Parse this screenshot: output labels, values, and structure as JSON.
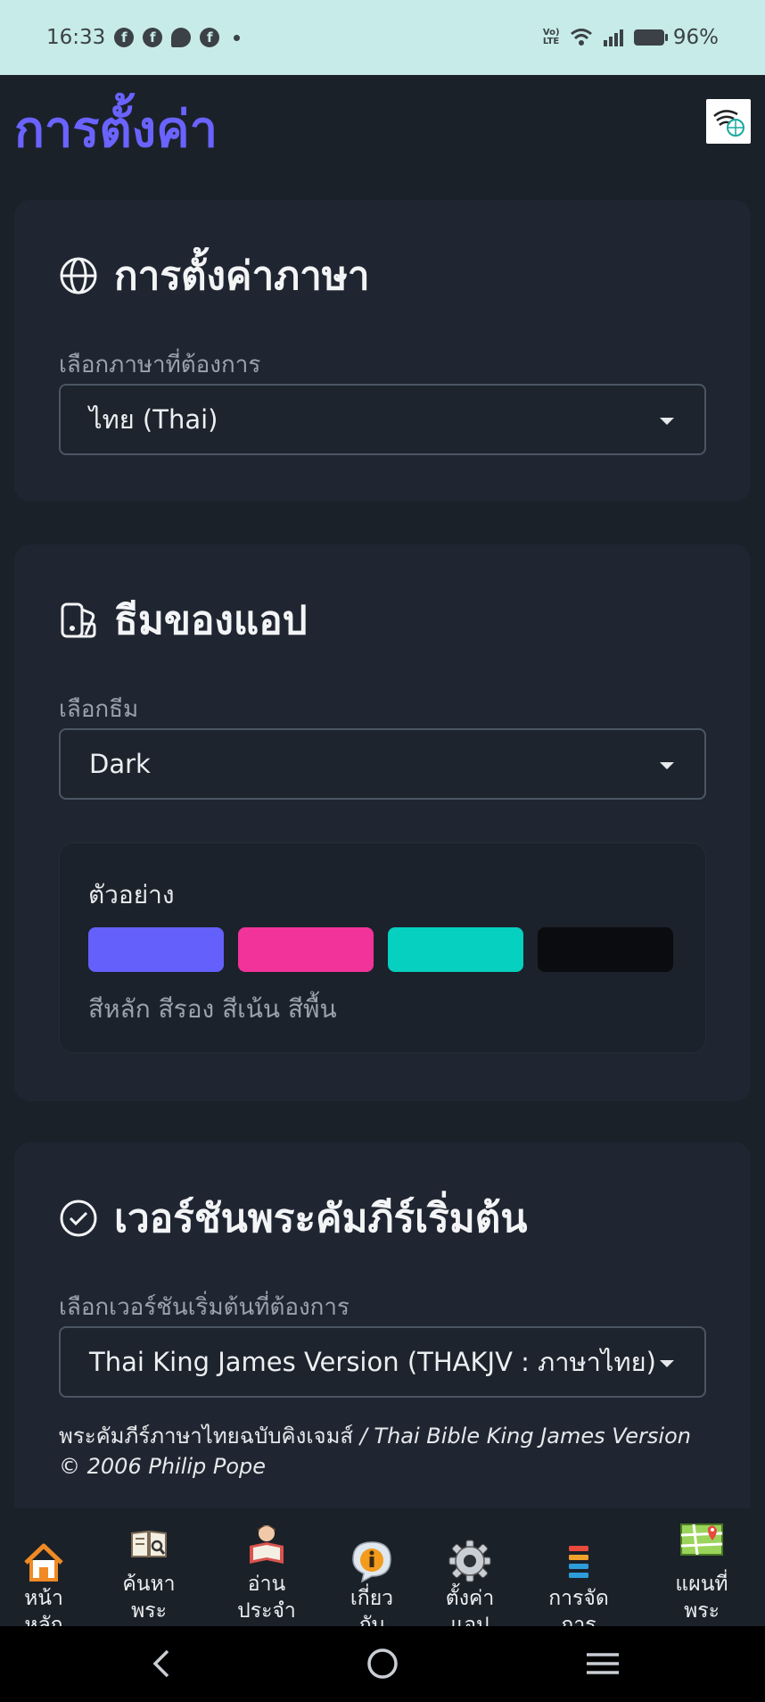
{
  "status_bar": {
    "time": "16:33",
    "notification_icons": [
      "facebook-icon",
      "facebook-icon",
      "messenger-icon",
      "facebook-icon"
    ],
    "volte_label": "Vo) LTE",
    "battery_text": "96%"
  },
  "header": {
    "title": "การตั้งค่า",
    "network_icon": "wifi-globe-icon"
  },
  "language_card": {
    "title": "การตั้งค่าภาษา",
    "icon": "globe-icon",
    "field_label": "เลือกภาษาที่ต้องการ",
    "selected": "ไทย (Thai)"
  },
  "theme_card": {
    "title": "ธีมของแอป",
    "icon": "palette-icon",
    "field_label": "เลือกธีม",
    "selected": "Dark",
    "preview": {
      "label": "ตัวอย่าง",
      "swatches": [
        {
          "name": "primary",
          "color": "#6460fb"
        },
        {
          "name": "secondary",
          "color": "#f2339a"
        },
        {
          "name": "accent",
          "color": "#06d0bf"
        },
        {
          "name": "background",
          "color": "#0b0c0f"
        }
      ],
      "caption": "สีหลัก สีรอง สีเน้น สีพื้น"
    }
  },
  "bible_card": {
    "title": "เวอร์ชันพระคัมภีร์เริ่มต้น",
    "icon": "check-circle-icon",
    "field_label": "เลือกเวอร์ชันเริ่มต้นที่ต้องการ",
    "selected": "Thai King James Version (THAKJV : ภาษาไทย)",
    "note_plain": "พระคัมภีร์ภาษาไทยฉบับคิงเจมส์",
    "note_italic": " / Thai Bible King James Version © 2006 Philip Pope"
  },
  "bottom_nav": {
    "items": [
      {
        "icon": "home-icon",
        "line1": "หน้า",
        "line2": "หลัก"
      },
      {
        "icon": "book-search-icon",
        "line1": "ค้นหา",
        "line2": "พระ"
      },
      {
        "icon": "reader-icon",
        "line1": "อ่าน",
        "line2": "ประจำ"
      },
      {
        "icon": "info-icon",
        "line1": "เกี่ยว",
        "line2": "กับ"
      },
      {
        "icon": "gear-icon",
        "line1": "ตั้งค่า",
        "line2": "แอป"
      },
      {
        "icon": "bookmarks-icon",
        "line1": "การจัด",
        "line2": "การ"
      },
      {
        "icon": "map-icon",
        "line1": "แผนที่",
        "line2": "พระ"
      }
    ]
  },
  "system_nav": {
    "back_icon": "back-chevron-icon",
    "home_icon": "home-circle-icon",
    "recents_icon": "menu-lines-icon"
  }
}
